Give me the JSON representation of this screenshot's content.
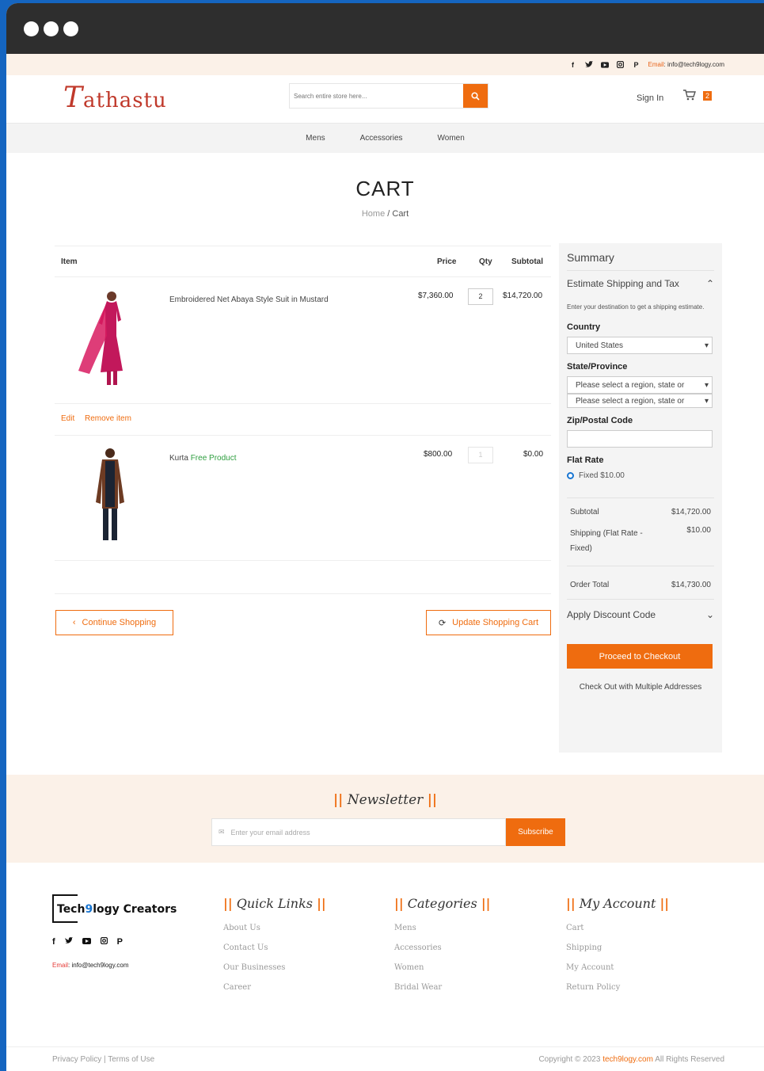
{
  "topbar": {
    "email_label": "Email",
    "email": "info@tech9logy.com"
  },
  "header": {
    "logo_first": "T",
    "logo_rest": "athastu",
    "search_placeholder": "Search entire store here...",
    "sign_in": "Sign In",
    "cart_count": "2"
  },
  "nav": [
    "Mens",
    "Accessories",
    "Women"
  ],
  "page": {
    "title": "CART",
    "breadcrumb_home": "Home",
    "breadcrumb_sep": "/",
    "breadcrumb_current": "Cart"
  },
  "table": {
    "headers": {
      "item": "Item",
      "price": "Price",
      "qty": "Qty",
      "subtotal": "Subtotal"
    },
    "items": [
      {
        "name": "Embroidered Net Abaya Style Suit in Mustard",
        "price": "$7,360.00",
        "qty": "2",
        "subtotal": "$14,720.00"
      },
      {
        "name": "Kurta",
        "free_label": "Free Product",
        "price": "$800.00",
        "qty": "1",
        "subtotal": "$0.00"
      }
    ],
    "edit": "Edit",
    "remove": "Remove item",
    "continue": "Continue Shopping",
    "update": "Update Shopping Cart"
  },
  "summary": {
    "title": "Summary",
    "estimate": "Estimate Shipping and Tax",
    "hint": "Enter your destination to get a shipping estimate.",
    "country_label": "Country",
    "country_value": "United States",
    "state_label": "State/Province",
    "state_placeholder": "Please select a region, state or",
    "zip_label": "Zip/Postal Code",
    "flat_label": "Flat Rate",
    "flat_option": "Fixed $10.00",
    "subtotal_label": "Subtotal",
    "subtotal_value": "$14,720.00",
    "shipping_label": "Shipping (Flat Rate - Fixed)",
    "shipping_value": "$10.00",
    "total_label": "Order Total",
    "total_value": "$14,730.00",
    "discount": "Apply Discount Code",
    "checkout": "Proceed to Checkout",
    "multi": "Check Out with Multiple Addresses"
  },
  "newsletter": {
    "title": "Newsletter",
    "placeholder": "Enter your email address",
    "button": "Subscribe"
  },
  "footer": {
    "brand_pre": "Tech",
    "brand_nine": "9",
    "brand_post": "logy Creators",
    "email_label": "Email",
    "email": "info@tech9logy.com",
    "quick_title": "Quick Links",
    "quick_links": [
      "About Us",
      "Contact Us",
      "Our Businesses",
      "Career"
    ],
    "cat_title": "Categories",
    "categories": [
      "Mens",
      "Accessories",
      "Women",
      "Bridal Wear"
    ],
    "acct_title": "My Account",
    "account_links": [
      "Cart",
      "Shipping",
      "My Account",
      "Return Policy"
    ],
    "privacy": "Privacy Policy",
    "terms": "Terms of Use",
    "copyright_pre": "Copyright © 2023",
    "copyright_brand": "tech9logy.com",
    "copyright_post": "All Rights Reserved"
  },
  "colors": {
    "accent": "#ef6c0f",
    "logo": "#c0392b",
    "free": "#2e9e3f"
  }
}
